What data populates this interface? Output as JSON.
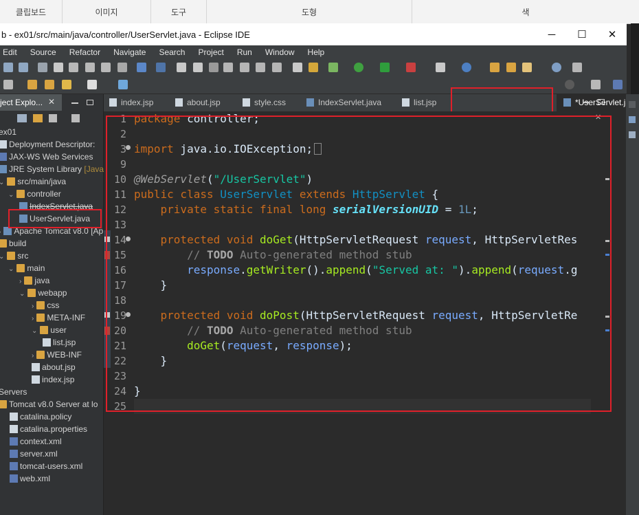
{
  "ribbon": {
    "clipboard": "클립보드",
    "image": "이미지",
    "tools": "도구",
    "shapes": "도형",
    "colors": "색"
  },
  "window": {
    "title": "b - ex01/src/main/java/controller/UserServlet.java - Eclipse IDE",
    "minimize": "─",
    "maximize": "☐",
    "close": "✕"
  },
  "menu": [
    "Edit",
    "Source",
    "Refactor",
    "Navigate",
    "Search",
    "Project",
    "Run",
    "Window",
    "Help"
  ],
  "left_panel": {
    "tab_label": "ject Explo...",
    "tree": [
      {
        "label": "ex01",
        "depth": 0,
        "icon": "project"
      },
      {
        "label": "Deployment Descriptor:",
        "depth": 0,
        "icon": "descriptor"
      },
      {
        "label": "JAX-WS Web Services",
        "depth": 0,
        "icon": "webservice"
      },
      {
        "label": "JRE System Library",
        "extra": "[Java",
        "depth": 0,
        "icon": "library"
      },
      {
        "label": "src/main/java",
        "depth": 0,
        "icon": "source-folder"
      },
      {
        "label": "controller",
        "depth": 1,
        "icon": "package"
      },
      {
        "label": "IndexServlet.java",
        "depth": 2,
        "icon": "java-file"
      },
      {
        "label": "UserServlet.java",
        "depth": 2,
        "icon": "java-file"
      },
      {
        "label": "Apache Tomcat v8.0 [Ap",
        "depth": 0,
        "icon": "library"
      },
      {
        "label": "build",
        "depth": 0,
        "icon": "folder"
      },
      {
        "label": "src",
        "depth": 0,
        "icon": "folder"
      },
      {
        "label": "main",
        "depth": 1,
        "icon": "folder"
      },
      {
        "label": "java",
        "depth": 2,
        "icon": "folder"
      },
      {
        "label": "webapp",
        "depth": 2,
        "icon": "folder"
      },
      {
        "label": "css",
        "depth": 3,
        "icon": "folder"
      },
      {
        "label": "META-INF",
        "depth": 3,
        "icon": "folder"
      },
      {
        "label": "user",
        "depth": 3,
        "icon": "folder"
      },
      {
        "label": "list.jsp",
        "depth": 4,
        "icon": "jsp-file"
      },
      {
        "label": "WEB-INF",
        "depth": 3,
        "icon": "folder"
      },
      {
        "label": "about.jsp",
        "depth": 3,
        "icon": "jsp-file"
      },
      {
        "label": "index.jsp",
        "depth": 3,
        "icon": "jsp-file"
      },
      {
        "label": "Servers",
        "depth": 0,
        "icon": "folder"
      },
      {
        "label": "Tomcat v8.0 Server at lo",
        "depth": 0,
        "icon": "folder"
      },
      {
        "label": "catalina.policy",
        "depth": 1,
        "icon": "file"
      },
      {
        "label": "catalina.properties",
        "depth": 1,
        "icon": "file"
      },
      {
        "label": "context.xml",
        "depth": 1,
        "icon": "xml-file"
      },
      {
        "label": "server.xml",
        "depth": 1,
        "icon": "xml-file"
      },
      {
        "label": "tomcat-users.xml",
        "depth": 1,
        "icon": "xml-file"
      },
      {
        "label": "web.xml",
        "depth": 1,
        "icon": "xml-file"
      }
    ]
  },
  "editor_tabs": [
    "index.jsp",
    "about.jsp",
    "style.css",
    "IndexServlet.java",
    "list.jsp"
  ],
  "active_tab": "*UserServlet.java",
  "code": {
    "line_numbers": [
      "1",
      "2",
      "3",
      "9",
      "10",
      "11",
      "12",
      "13",
      "14",
      "15",
      "16",
      "17",
      "18",
      "19",
      "20",
      "21",
      "22",
      "23",
      "24",
      "25"
    ],
    "l1": {
      "kw": "package",
      "rest": " controller;"
    },
    "l3": {
      "kw": "import",
      "rest": " java.io.IOException;"
    },
    "l10": {
      "ann": "@WebServlet",
      "open": "(",
      "str": "\"/UserServlet\"",
      "close": ")"
    },
    "l11": {
      "kw1": "public class",
      "t1": " UserServlet ",
      "kw2": "extends",
      "t2": " HttpServlet",
      "rest": " {"
    },
    "l12": {
      "kw": "private static final long",
      "fld": "serialVersionUID",
      "eq": " = ",
      "num": "1L",
      "end": ";"
    },
    "l14": {
      "kw": "protected void",
      "m": "doGet",
      "p1": "(HttpServletRequest ",
      "v1": "request",
      "p2": ", HttpServletRes"
    },
    "l15": {
      "c1": "// ",
      "todo": "TODO",
      "c2": " Auto-generated method stub"
    },
    "l16": {
      "v1": "response",
      "d1": ".",
      "m1": "getWriter",
      "d2": "().",
      "m2": "append",
      "o": "(",
      "s": "\"Served at: \"",
      "d3": ").",
      "m3": "append",
      "o2": "(",
      "v2": "request",
      "d4": ".g"
    },
    "l17": "}",
    "l19": {
      "kw": "protected void",
      "m": "doPost",
      "p1": "(HttpServletRequest ",
      "v1": "request",
      "p2": ", HttpServletRe"
    },
    "l20": {
      "c1": "// ",
      "todo": "TODO",
      "c2": " Auto-generated method stub"
    },
    "l21": {
      "m": "doGet",
      "o": "(",
      "v1": "request",
      "c": ", ",
      "v2": "response",
      "e": ");"
    },
    "l22": "}",
    "l24": "}"
  },
  "colors": {
    "highlight": "#e0202a",
    "background": "#2b2b2b"
  }
}
